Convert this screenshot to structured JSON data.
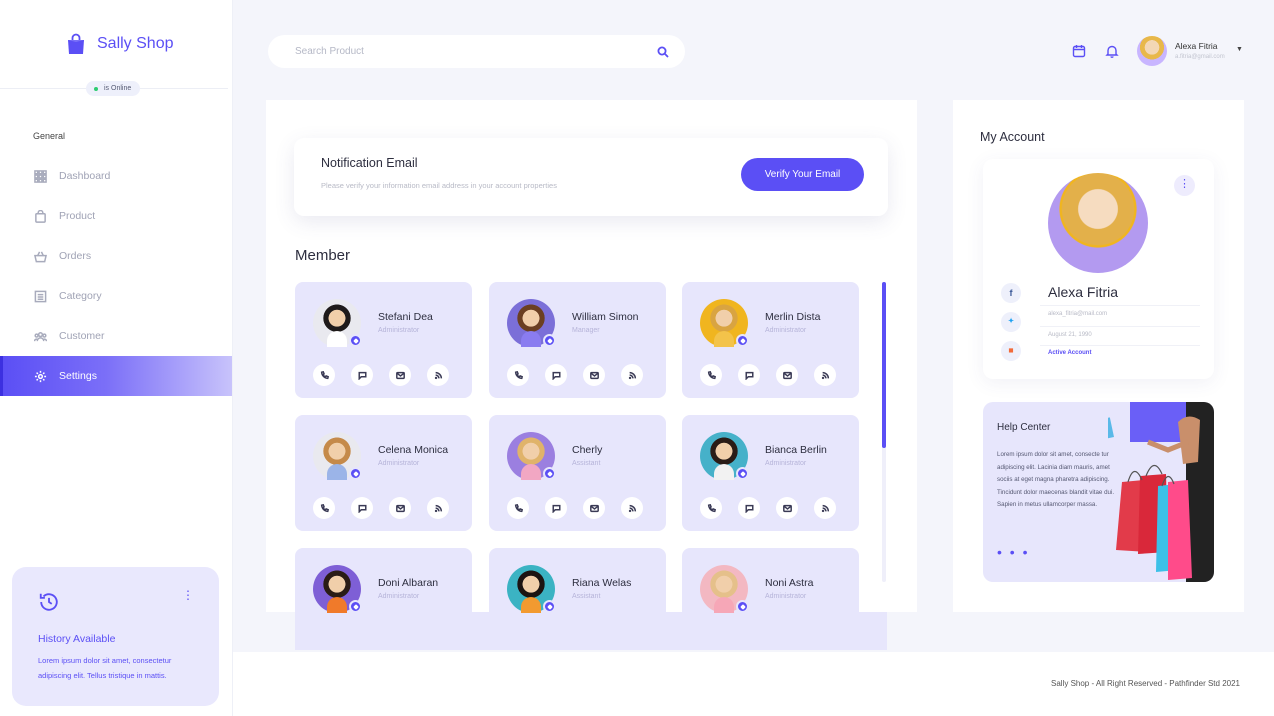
{
  "brand": {
    "name": "Sally Shop",
    "status": "is Online"
  },
  "sidebar": {
    "section_label": "General",
    "items": [
      {
        "label": "Dashboard",
        "icon": "grid-icon",
        "active": false
      },
      {
        "label": "Product",
        "icon": "bag-icon",
        "active": false
      },
      {
        "label": "Orders",
        "icon": "basket-icon",
        "active": false
      },
      {
        "label": "Category",
        "icon": "category-icon",
        "active": false
      },
      {
        "label": "Customer",
        "icon": "users-icon",
        "active": false
      },
      {
        "label": "Settings",
        "icon": "gear-icon",
        "active": true
      }
    ],
    "history": {
      "title": "History Available",
      "text": "Lorem ipsum dolor sit amet, consectetur adipiscing elit. Tellus tristique in mattis."
    }
  },
  "header": {
    "search_placeholder": "Search Product",
    "user": {
      "name": "Alexa Fitria",
      "email": "a.fitria@gmail.com"
    }
  },
  "notification": {
    "title": "Notification Email",
    "subtitle": "Please verify your information email address in your account properties",
    "button": "Verify Your Email"
  },
  "members": {
    "title": "Member",
    "list": [
      {
        "name": "Stefani Dea",
        "role": "Administrator",
        "avatar_bg": "#e9e9ef",
        "hair": "#1e1a1a",
        "shirt": "#ffffff"
      },
      {
        "name": "William Simon",
        "role": "Manager",
        "avatar_bg": "#7b6fd8",
        "hair": "#6b3f22",
        "shirt": "#8a7cf0"
      },
      {
        "name": "Merlin Dista",
        "role": "Administrator",
        "avatar_bg": "#f0b51f",
        "hair": "#d9a441",
        "shirt": "#f3c34a"
      },
      {
        "name": "Celena Monica",
        "role": "Administrator",
        "avatar_bg": "#e9e9ef",
        "hair": "#c58a4a",
        "shirt": "#9bb4e8"
      },
      {
        "name": "Cherly",
        "role": "Assistant",
        "avatar_bg": "#9b7fe0",
        "hair": "#e0b36a",
        "shirt": "#f2a7c3"
      },
      {
        "name": "Bianca Berlin",
        "role": "Administrator",
        "avatar_bg": "#46b1c9",
        "hair": "#2a1c16",
        "shirt": "#f2f2f2"
      },
      {
        "name": "Doni Albaran",
        "role": "Administrator",
        "avatar_bg": "#7e5fd6",
        "hair": "#2a1c16",
        "shirt": "#f07a2a"
      },
      {
        "name": "Riana Welas",
        "role": "Assistant",
        "avatar_bg": "#3bb3c3",
        "hair": "#1c1412",
        "shirt": "#f29a30"
      },
      {
        "name": "Noni Astra",
        "role": "Administrator",
        "avatar_bg": "#f3b8c2",
        "hair": "#e5c08a",
        "shirt": "#f6a7b7"
      }
    ]
  },
  "account": {
    "title": "My Account",
    "name": "Alexa Fitria",
    "email": "alexa_fitria@mail.com",
    "birthday": "August 21, 1990",
    "status": "Active Account",
    "socials": [
      "f",
      "t",
      "ig"
    ]
  },
  "help": {
    "title": "Help Center",
    "text": "Lorem ipsum dolor sit amet, consecte tur adipiscing elit. Lacinia diam mauris, amet sociis at eget magna pharetra adipiscing. Tincidunt dolor maecenas blandit vitae dui. Sapien in metus ullamcorper massa."
  },
  "footer": {
    "text": "Sally Shop - All Right Reserved - Pathfinder Std 2021"
  },
  "colors": {
    "accent": "#5b4ff5",
    "card": "#e7e6fc"
  }
}
